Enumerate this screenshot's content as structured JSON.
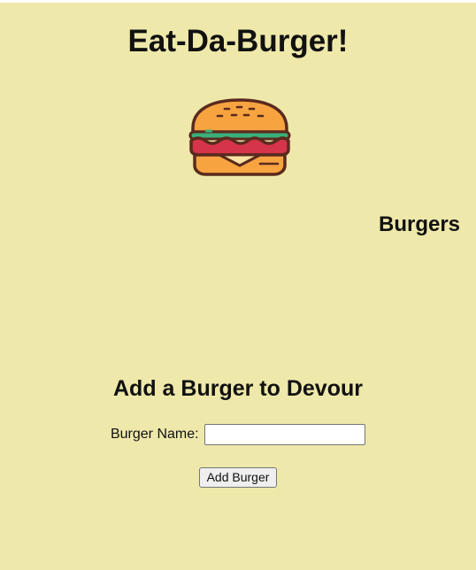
{
  "header": {
    "title": "Eat-Da-Burger!",
    "logo_icon": "burger-icon"
  },
  "burgers_section": {
    "heading": "Burgers"
  },
  "add_form": {
    "heading": "Add a Burger to Devour",
    "name_label": "Burger Name:",
    "name_value": "",
    "submit_label": "Add Burger"
  },
  "colors": {
    "page_background": "#eee8aa",
    "bun": "#f7a440",
    "outline": "#5a2a1e",
    "lettuce": "#3ab07a",
    "tomato": "#d6344a",
    "cheese": "#f8e3a3"
  }
}
